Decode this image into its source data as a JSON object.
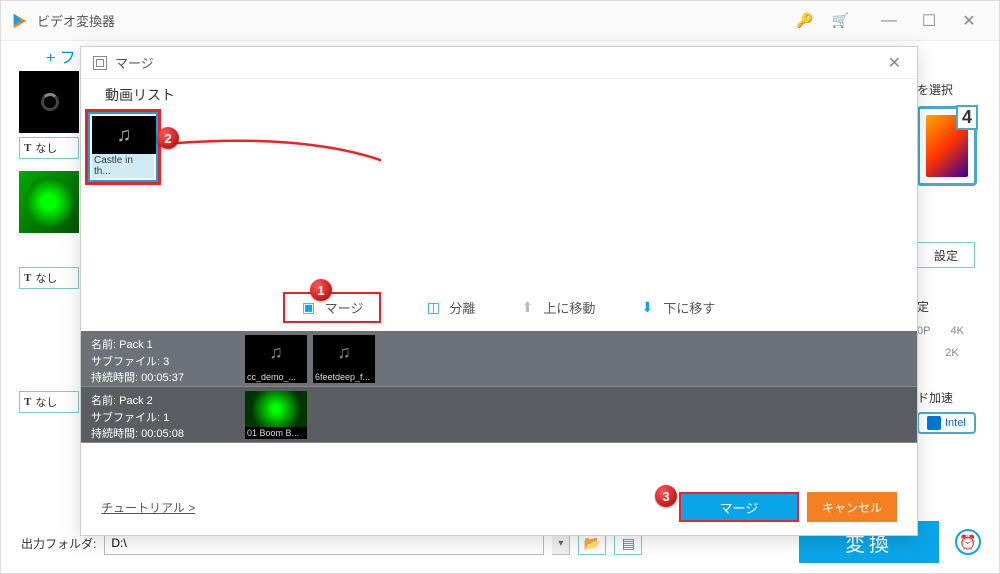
{
  "app": {
    "title": "ビデオ変換器",
    "add_label": "+ フ"
  },
  "sidebar_clips": {
    "label_none": "なし"
  },
  "right": {
    "select_label": "を選択",
    "format_digit": "4",
    "setting_label": "設定",
    "quality_label": "定",
    "res_left": "0P",
    "res_right": "4K",
    "res_bottom": "2K",
    "accel_label": "ド加速",
    "intel": "Intel"
  },
  "bottom": {
    "output_label": "出力フォルダ:",
    "output_value": "D:\\",
    "convert_label": "変換"
  },
  "modal": {
    "title": "マージ",
    "list_label": "動画リスト",
    "thumb_caption": "Castle in th...",
    "actions": {
      "merge": "マージ",
      "split": "分離",
      "move_up": "上に移動",
      "move_down": "下に移す"
    },
    "packs": [
      {
        "name_label": "名前:",
        "name": "Pack 1",
        "sub_label": "サブファイル:",
        "sub_count": "3",
        "dur_label": "持続時間:",
        "duration": "00:05:37",
        "thumbs": [
          "cc_demo_...",
          "6feetdeep_f..."
        ]
      },
      {
        "name_label": "名前:",
        "name": "Pack 2",
        "sub_label": "サブファイル:",
        "sub_count": "1",
        "dur_label": "持続時間:",
        "duration": "00:05:08",
        "thumbs": [
          "01 Boom B..."
        ]
      }
    ],
    "tutorial": "チュートリアル >",
    "merge_btn": "マージ",
    "cancel_btn": "キャンセル"
  },
  "annotations": {
    "badge1": "1",
    "badge2": "2",
    "badge3": "3"
  }
}
